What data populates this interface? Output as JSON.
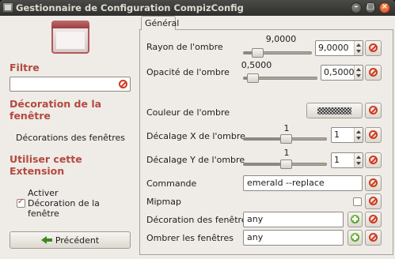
{
  "window": {
    "title": "Gestionnaire de Configuration CompizConfig",
    "controls": [
      "minimize-icon",
      "maximize-icon",
      "close-icon"
    ]
  },
  "sidebar": {
    "filter_title": "Filtre",
    "filter_value": "",
    "plugin_title_line1": "Décoration de la",
    "plugin_title_line2": "fenêtre",
    "category_item": "Décorations des fenêtres",
    "use_ext_line1": "Utiliser cette",
    "use_ext_line2": "Extension",
    "enable_line1": "Activer",
    "enable_line2": "Décoration de la",
    "enable_line3": "fenêtre",
    "enable_checked": true,
    "prev_button": "Précédent"
  },
  "main": {
    "tab": "Général",
    "settings": [
      {
        "label": "Rayon de l'ombre",
        "type": "slider-spin",
        "slider_value": "9,0000",
        "value": "9,0000",
        "fraction": 0.14
      },
      {
        "label": "Opacité de l'ombre",
        "type": "slider-spin",
        "slider_value": "0,5000",
        "value": "0,5000",
        "fraction": 0.05
      },
      {
        "label": "Couleur de l'ombre",
        "type": "color"
      },
      {
        "label": "Décalage X de l'ombre",
        "type": "slider-spin",
        "slider_value": "1",
        "value": "1",
        "fraction": 0.52
      },
      {
        "label": "Décalage Y de l'ombre",
        "type": "slider-spin",
        "slider_value": "1",
        "value": "1",
        "fraction": 0.52
      },
      {
        "label": "Commande",
        "type": "text",
        "value": "emerald --replace"
      },
      {
        "label": "Mipmap",
        "type": "checkbox",
        "checked": false
      },
      {
        "label": "Décoration des fenêtres",
        "type": "text-add",
        "value": "any"
      },
      {
        "label": "Ombrer les fenêtres",
        "type": "text-add",
        "value": "any"
      }
    ]
  },
  "colors": {
    "section_title": "#b34a3f",
    "reset_icon": "#d3381f",
    "add_icon": "#3f8a16",
    "titlebar": "#3a3a38"
  }
}
